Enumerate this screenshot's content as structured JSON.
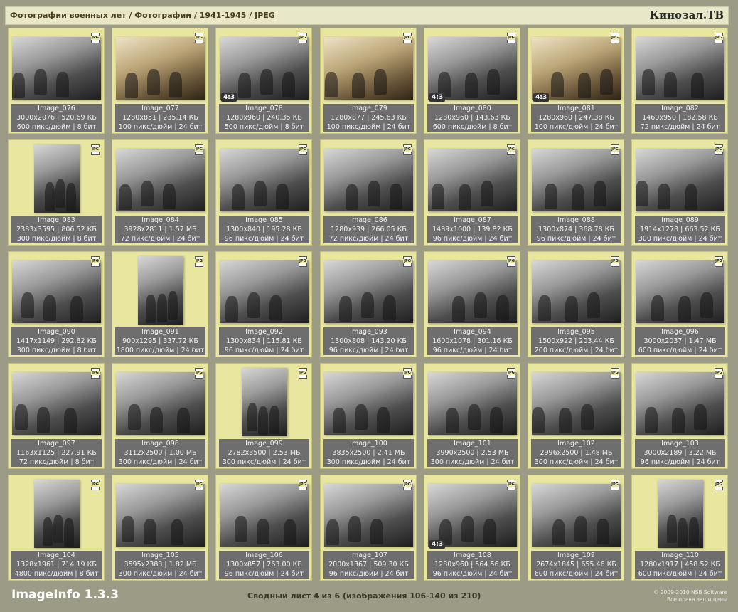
{
  "header": {
    "breadcrumb": "Фотографии военных лет / Фотографии / 1941-1945 / JPEG",
    "brand": "Кинозал.ТВ"
  },
  "file_type_badge": "JPG",
  "items": [
    {
      "name": "Image_076",
      "dims": "3000x2076 | 520.69 КБ",
      "meta": "600 пикс/дюйм | 8 бит",
      "ratio": "",
      "tone": "gray",
      "orient": "land"
    },
    {
      "name": "Image_077",
      "dims": "1280x851 | 235.14 КБ",
      "meta": "100 пикс/дюйм | 24 бит",
      "ratio": "",
      "tone": "sepia",
      "orient": "land"
    },
    {
      "name": "Image_078",
      "dims": "1280x960 | 240.35 КБ",
      "meta": "500 пикс/дюйм | 8 бит",
      "ratio": "4:3",
      "tone": "gray",
      "orient": "land"
    },
    {
      "name": "Image_079",
      "dims": "1280x877 | 245.63 КБ",
      "meta": "100 пикс/дюйм | 24 бит",
      "ratio": "",
      "tone": "sepia",
      "orient": "land"
    },
    {
      "name": "Image_080",
      "dims": "1280x960 | 143.63 КБ",
      "meta": "600 пикс/дюйм | 8 бит",
      "ratio": "4:3",
      "tone": "gray",
      "orient": "land"
    },
    {
      "name": "Image_081",
      "dims": "1280x960 | 247.38 КБ",
      "meta": "100 пикс/дюйм | 24 бит",
      "ratio": "4:3",
      "tone": "sepia",
      "orient": "land"
    },
    {
      "name": "Image_082",
      "dims": "1460x950 | 182.58 КБ",
      "meta": "72 пикс/дюйм | 24 бит",
      "ratio": "",
      "tone": "gray",
      "orient": "land"
    },
    {
      "name": "Image_083",
      "dims": "2383x3595 | 806.52 КБ",
      "meta": "300 пикс/дюйм | 8 бит",
      "ratio": "",
      "tone": "gray",
      "orient": "port"
    },
    {
      "name": "Image_084",
      "dims": "3928x2811 | 1.57 МБ",
      "meta": "72 пикс/дюйм | 24 бит",
      "ratio": "",
      "tone": "gray",
      "orient": "land"
    },
    {
      "name": "Image_085",
      "dims": "1300x840 | 195.28 КБ",
      "meta": "96 пикс/дюйм | 24 бит",
      "ratio": "",
      "tone": "gray",
      "orient": "land"
    },
    {
      "name": "Image_086",
      "dims": "1280x939 | 266.05 КБ",
      "meta": "72 пикс/дюйм | 24 бит",
      "ratio": "",
      "tone": "gray",
      "orient": "land"
    },
    {
      "name": "Image_087",
      "dims": "1489x1000 | 139.82 КБ",
      "meta": "96 пикс/дюйм | 24 бит",
      "ratio": "",
      "tone": "gray",
      "orient": "land"
    },
    {
      "name": "Image_088",
      "dims": "1300x874 | 368.78 КБ",
      "meta": "96 пикс/дюйм | 24 бит",
      "ratio": "",
      "tone": "gray",
      "orient": "land"
    },
    {
      "name": "Image_089",
      "dims": "1914x1278 | 663.52 КБ",
      "meta": "300 пикс/дюйм | 24 бит",
      "ratio": "",
      "tone": "gray",
      "orient": "land"
    },
    {
      "name": "Image_090",
      "dims": "1417x1149 | 292.82 КБ",
      "meta": "300 пикс/дюйм | 8 бит",
      "ratio": "",
      "tone": "gray",
      "orient": "land"
    },
    {
      "name": "Image_091",
      "dims": "900x1295 | 337.72 КБ",
      "meta": "1800 пикс/дюйм | 24 бит",
      "ratio": "",
      "tone": "gray",
      "orient": "port"
    },
    {
      "name": "Image_092",
      "dims": "1300x834 | 115.81 КБ",
      "meta": "96 пикс/дюйм | 24 бит",
      "ratio": "",
      "tone": "gray",
      "orient": "land"
    },
    {
      "name": "Image_093",
      "dims": "1300x808 | 143.20 КБ",
      "meta": "96 пикс/дюйм | 24 бит",
      "ratio": "",
      "tone": "gray",
      "orient": "land"
    },
    {
      "name": "Image_094",
      "dims": "1600x1078 | 301.16 КБ",
      "meta": "96 пикс/дюйм | 24 бит",
      "ratio": "",
      "tone": "gray",
      "orient": "land"
    },
    {
      "name": "Image_095",
      "dims": "1500x922 | 203.44 КБ",
      "meta": "200 пикс/дюйм | 24 бит",
      "ratio": "",
      "tone": "gray",
      "orient": "land"
    },
    {
      "name": "Image_096",
      "dims": "3000x2037 | 1.47 МБ",
      "meta": "600 пикс/дюйм | 24 бит",
      "ratio": "",
      "tone": "gray",
      "orient": "land"
    },
    {
      "name": "Image_097",
      "dims": "1163x1125 | 227.91 КБ",
      "meta": "72 пикс/дюйм | 8 бит",
      "ratio": "",
      "tone": "gray",
      "orient": "land"
    },
    {
      "name": "Image_098",
      "dims": "3112x2500 | 1.00 МБ",
      "meta": "300 пикс/дюйм | 24 бит",
      "ratio": "",
      "tone": "gray",
      "orient": "land"
    },
    {
      "name": "Image_099",
      "dims": "2782x3500 | 2.53 МБ",
      "meta": "300 пикс/дюйм | 24 бит",
      "ratio": "",
      "tone": "gray",
      "orient": "port"
    },
    {
      "name": "Image_100",
      "dims": "3835x2500 | 2.41 МБ",
      "meta": "300 пикс/дюйм | 24 бит",
      "ratio": "",
      "tone": "gray",
      "orient": "land"
    },
    {
      "name": "Image_101",
      "dims": "3990x2500 | 2.53 МБ",
      "meta": "300 пикс/дюйм | 24 бит",
      "ratio": "",
      "tone": "gray",
      "orient": "land"
    },
    {
      "name": "Image_102",
      "dims": "2996x2500 | 1.48 МБ",
      "meta": "300 пикс/дюйм | 24 бит",
      "ratio": "",
      "tone": "gray",
      "orient": "land"
    },
    {
      "name": "Image_103",
      "dims": "3000x2189 | 3.22 МБ",
      "meta": "96 пикс/дюйм | 24 бит",
      "ratio": "",
      "tone": "gray",
      "orient": "land"
    },
    {
      "name": "Image_104",
      "dims": "1328x1961 | 714.19 КБ",
      "meta": "4800 пикс/дюйм | 8 бит",
      "ratio": "",
      "tone": "gray",
      "orient": "port"
    },
    {
      "name": "Image_105",
      "dims": "3595x2383 | 1.82 МБ",
      "meta": "300 пикс/дюйм | 24 бит",
      "ratio": "",
      "tone": "gray",
      "orient": "land"
    },
    {
      "name": "Image_106",
      "dims": "1300x857 | 263.00 КБ",
      "meta": "96 пикс/дюйм | 24 бит",
      "ratio": "",
      "tone": "gray",
      "orient": "land"
    },
    {
      "name": "Image_107",
      "dims": "2000x1367 | 509.30 КБ",
      "meta": "96 пикс/дюйм | 24 бит",
      "ratio": "",
      "tone": "gray",
      "orient": "land"
    },
    {
      "name": "Image_108",
      "dims": "1280x960 | 564.56 КБ",
      "meta": "96 пикс/дюйм | 24 бит",
      "ratio": "4:3",
      "tone": "gray",
      "orient": "land"
    },
    {
      "name": "Image_109",
      "dims": "2674x1845 | 655.46 КБ",
      "meta": "600 пикс/дюйм | 24 бит",
      "ratio": "",
      "tone": "gray",
      "orient": "land"
    },
    {
      "name": "Image_110",
      "dims": "1280x1917 | 458.52 КБ",
      "meta": "600 пикс/дюйм | 24 бит",
      "ratio": "",
      "tone": "gray",
      "orient": "port"
    }
  ],
  "footer": {
    "app_name": "ImageInfo 1.3.3",
    "sheet_info": "Сводный лист 4 из 6 (изображения 106-140 из 210)",
    "copyright": "© 2009-2010 NSB Software",
    "rights": "Все права защищены"
  }
}
